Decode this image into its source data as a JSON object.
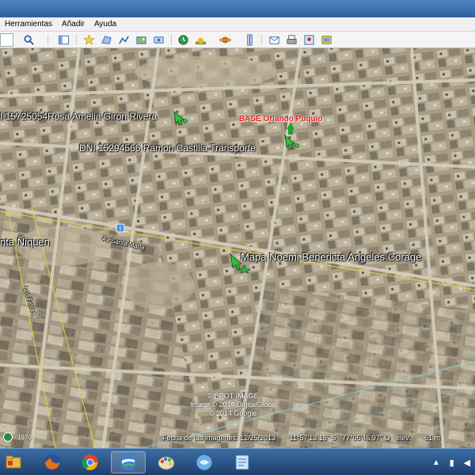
{
  "menu": {
    "items": [
      "Herramientas",
      "Añadir",
      "Ayuda"
    ]
  },
  "toolbar": {
    "icons": [
      "search-icon",
      "sidebar-toggle-icon",
      "placemark-icon",
      "polygon-icon",
      "path-icon",
      "image-overlay-icon",
      "tour-icon",
      "historical-imagery-icon",
      "sunlight-icon",
      "planets-icon",
      "ruler-icon",
      "email-icon",
      "print-icon",
      "maps-view-icon",
      "save-image-icon"
    ]
  },
  "map": {
    "placemarks": [
      {
        "id": "rosa",
        "label": "I 15725054Rosa Amelia Giron Rivera"
      },
      {
        "id": "base",
        "label": "BASE Orlando Puquio"
      },
      {
        "id": "ramon",
        "label": "DNI 15294566 Ramon Castilla Transporte"
      },
      {
        "id": "noemi",
        "label": "Mapa Noemi Benericta Angeles Corage"
      }
    ],
    "place_label": "nta Ñiquen",
    "roads": {
      "av_santa_maria": "Av Santa Maria",
      "los_flores": "Los Flores"
    },
    "credits": [
      "© SPOT IMAGE",
      "Image © 2014 DigitalGlobe",
      "© 2014 Google"
    ],
    "historical_year": "1970",
    "status": {
      "date_label": "Fecha de las imágenes:",
      "date_value": "12/25/2013",
      "lat": "11°57'13.16\" S",
      "lon": "77°05'46.97\" O",
      "elev_label": "elev.",
      "elev_value": "61 m"
    }
  },
  "taskbar": {
    "apps": [
      "folder-icon",
      "firefox-icon",
      "chrome-icon",
      "google-earth-icon",
      "paint-icon",
      "maps-icon",
      "notepad-icon"
    ],
    "active_app": "google-earth-icon"
  },
  "colors": {
    "terrain": "#b3a890",
    "road": "#d6cfbd",
    "highlight_line": "#e6d24a",
    "title_bar": "#2d5f9e",
    "taskbar": "#1d3f6c",
    "base_label": "#e02020"
  }
}
